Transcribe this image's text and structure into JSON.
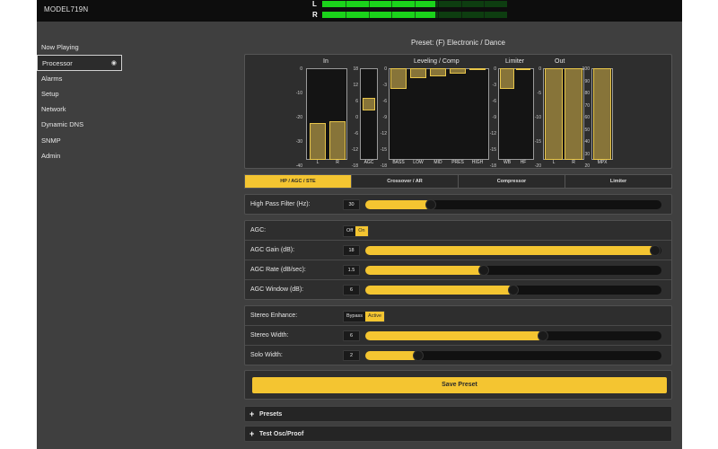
{
  "header": {
    "model": "MODEL719N",
    "meters": [
      {
        "label": "L",
        "level": 0.61
      },
      {
        "label": "R",
        "level": 0.61
      }
    ]
  },
  "sidebar": {
    "items": [
      {
        "label": "Now Playing",
        "active": false
      },
      {
        "label": "Processor",
        "active": true
      },
      {
        "label": "Alarms",
        "active": false
      },
      {
        "label": "Setup",
        "active": false
      },
      {
        "label": "Network",
        "active": false
      },
      {
        "label": "Dynamic DNS",
        "active": false
      },
      {
        "label": "SNMP",
        "active": false
      },
      {
        "label": "Admin",
        "active": false
      }
    ]
  },
  "preset": {
    "title": "Preset: (F) Electronic / Dance"
  },
  "meters": {
    "in": {
      "title": "In",
      "scale": [
        "0",
        "-10",
        "-20",
        "-30",
        "-40"
      ],
      "bars": [
        {
          "label": "L",
          "level_db": -24
        },
        {
          "label": "R",
          "level_db": -23
        }
      ]
    },
    "agc": {
      "scale": [
        "18",
        "12",
        "6",
        "0",
        "-6",
        "-12",
        "-18"
      ],
      "bars": [
        {
          "label": "AGC",
          "level_db": 6.5,
          "base_db": 1.5
        }
      ]
    },
    "leveling": {
      "title": "Leveling / Comp",
      "scale": [
        "0",
        "-3",
        "-6",
        "-9",
        "-12",
        "-15",
        "-18"
      ],
      "bars": [
        {
          "label": "BASS",
          "level_db": -4
        },
        {
          "label": "LOW",
          "level_db": -2
        },
        {
          "label": "MID",
          "level_db": -1.5
        },
        {
          "label": "PRES",
          "level_db": -1
        },
        {
          "label": "HIGH",
          "level_db": -0.3
        }
      ]
    },
    "limiter": {
      "title": "Limiter",
      "scale": [
        "0",
        "-3",
        "-6",
        "-9",
        "-12",
        "-15",
        "-18"
      ],
      "bars": [
        {
          "label": "WB",
          "level_db": -4
        },
        {
          "label": "HF",
          "level_db": 0
        }
      ]
    },
    "out": {
      "title": "Out",
      "scale": [
        "0",
        "-5",
        "-10",
        "-15",
        "-20"
      ],
      "bars": [
        {
          "label": "L",
          "level_db": 0
        },
        {
          "label": "R",
          "level_db": 0
        }
      ]
    },
    "mpx": {
      "scale": [
        "100",
        "90",
        "80",
        "70",
        "60",
        "50",
        "40",
        "30",
        "20"
      ],
      "bars": [
        {
          "label": "MPX",
          "level_pct": 100
        }
      ]
    }
  },
  "tabs": [
    {
      "label": "HP / AGC / STE",
      "active": true
    },
    {
      "label": "Crossover / AR",
      "active": false
    },
    {
      "label": "Compressor",
      "active": false
    },
    {
      "label": "Limiter",
      "active": false
    }
  ],
  "controls": {
    "hpf": {
      "label": "High Pass Filter (Hz):",
      "value": "30",
      "fraction": 0.22
    },
    "agc": {
      "label": "AGC:",
      "off": "Off",
      "on": "On",
      "state": "on"
    },
    "agc_gain": {
      "label": "AGC Gain (dB):",
      "value": "18",
      "fraction": 0.98
    },
    "agc_rate": {
      "label": "AGC Rate (dB/sec):",
      "value": "1.5",
      "fraction": 0.4
    },
    "agc_window": {
      "label": "AGC Window (dB):",
      "value": "6",
      "fraction": 0.5
    },
    "stereo_enhance": {
      "label": "Stereo Enhance:",
      "bypass": "Bypass",
      "active": "Active",
      "state": "active"
    },
    "stereo_width": {
      "label": "Stereo Width:",
      "value": "6",
      "fraction": 0.6
    },
    "solo_width": {
      "label": "Solo Width:",
      "value": "2",
      "fraction": 0.18
    }
  },
  "actions": {
    "save_preset": "Save Preset"
  },
  "sections": [
    {
      "label": "Presets"
    },
    {
      "label": "Test Osc/Proof"
    }
  ],
  "colors": {
    "accent": "#f4c531",
    "meter_green": "#1bd31b",
    "bar_gold": "#ad9446",
    "background": "#3f3f3f"
  }
}
